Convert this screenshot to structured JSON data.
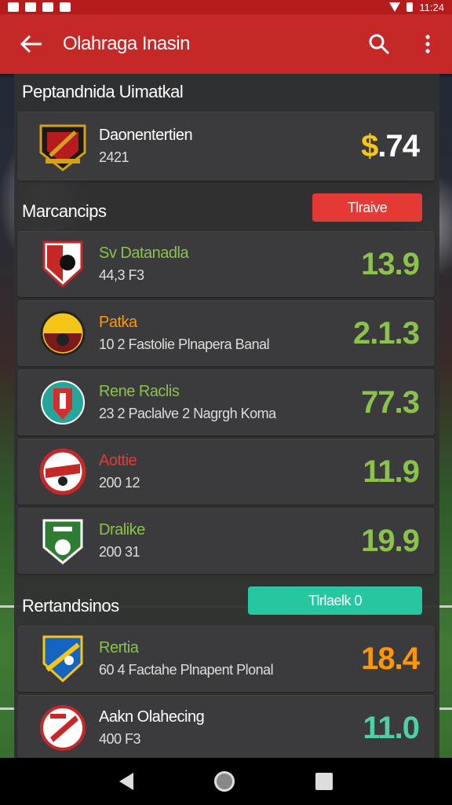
{
  "status": {
    "time": "11:24"
  },
  "appbar": {
    "back_icon": "arrow-left-icon",
    "title": "Olahraga Inasin",
    "search_icon": "search-icon",
    "more_icon": "more-vert-icon"
  },
  "featured": {
    "heading": "Peptandnida Uimatkal",
    "card": {
      "name": "Daonentertien",
      "sub": "2421",
      "score_symbol": "$",
      "score": ".74"
    }
  },
  "section1": {
    "heading": "Marcancips",
    "pill": {
      "label": "Tlraive",
      "color": "#e53935"
    },
    "items": [
      {
        "name": "Sv Datanadla",
        "sub": "44,3 F3",
        "score": "13.9",
        "name_color": "#8bc34a",
        "score_color": "#8bc34a"
      },
      {
        "name": "Patka",
        "sub": "10 2 Fastolie Plnapera Banal",
        "score": "2.1.3",
        "name_color": "#ff9800",
        "score_color": "#8bc34a"
      },
      {
        "name": "Rene Raclis",
        "sub": "23 2 Paclalve 2 Nagrgh Koma",
        "score": "77.3",
        "name_color": "#8bc34a",
        "score_color": "#8bc34a"
      },
      {
        "name": "Aottie",
        "sub": "200 12",
        "score": "11.9",
        "name_color": "#e53935",
        "score_color": "#8bc34a"
      },
      {
        "name": "Dralike",
        "sub": "200 31",
        "score": "19.9",
        "name_color": "#8bc34a",
        "score_color": "#8bc34a"
      }
    ]
  },
  "section2": {
    "heading": "Rertandsinos",
    "pill": {
      "label": "Tlrlaelk 0",
      "color": "#26c6a0"
    },
    "items": [
      {
        "name": "Rertia",
        "sub": "60 4 Factahe Plnapent Plonal",
        "score": "18.4",
        "name_color": "#8bc34a",
        "score_color": "#ff9800"
      },
      {
        "name": "Aakn Olahecing",
        "sub": "400 F3",
        "score": "11.0",
        "name_color": "#ffffff",
        "score_color": "#4dd0a8"
      }
    ]
  }
}
